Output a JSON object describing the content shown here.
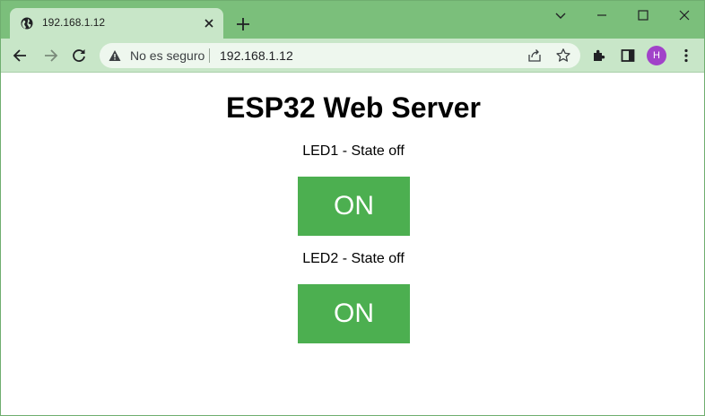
{
  "browser": {
    "tab": {
      "title": "192.168.1.12"
    },
    "address_bar": {
      "security_label": "No es seguro",
      "url": "192.168.1.12"
    },
    "profile_initial": "H",
    "avatar_color": "#a142c9",
    "frame_color": "#7bbf7b",
    "toolbar_color": "#c8e6c8"
  },
  "page": {
    "title": "ESP32 Web Server",
    "leds": [
      {
        "label": "LED1 - State off",
        "button_label": "ON"
      },
      {
        "label": "LED2 - State off",
        "button_label": "ON"
      }
    ],
    "button_color": "#4caf50"
  }
}
